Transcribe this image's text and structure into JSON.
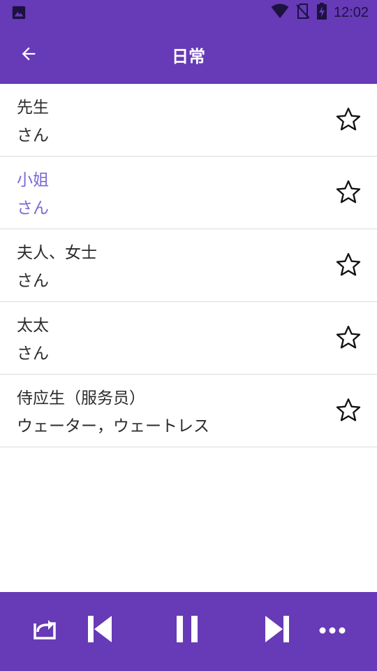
{
  "status_bar": {
    "time": "12:02",
    "icons": [
      "image-icon",
      "wifi-icon",
      "no-sim-icon",
      "battery-charging-icon"
    ]
  },
  "app_bar": {
    "title": "日常",
    "back_icon": "arrow-left-icon"
  },
  "items": [
    {
      "line1": "先生",
      "line2": "さん",
      "favorite": false,
      "active": false
    },
    {
      "line1": "小姐",
      "line2": "さん",
      "favorite": false,
      "active": true
    },
    {
      "line1": "夫人、女士",
      "line2": "さん",
      "favorite": false,
      "active": false
    },
    {
      "line1": "太太",
      "line2": "さん",
      "favorite": false,
      "active": false
    },
    {
      "line1": "侍应生（服务员）",
      "line2": "ウェーター，ウェートレス",
      "favorite": false,
      "active": false
    }
  ],
  "player": {
    "controls": [
      "repeat-icon",
      "skip-previous-icon",
      "pause-icon",
      "skip-next-icon",
      "more-horizontal-icon"
    ]
  },
  "colors": {
    "primary": "#673ab7",
    "active_text": "#7b68d6",
    "text": "#2b2b2b",
    "divider": "#dcdcdc"
  }
}
